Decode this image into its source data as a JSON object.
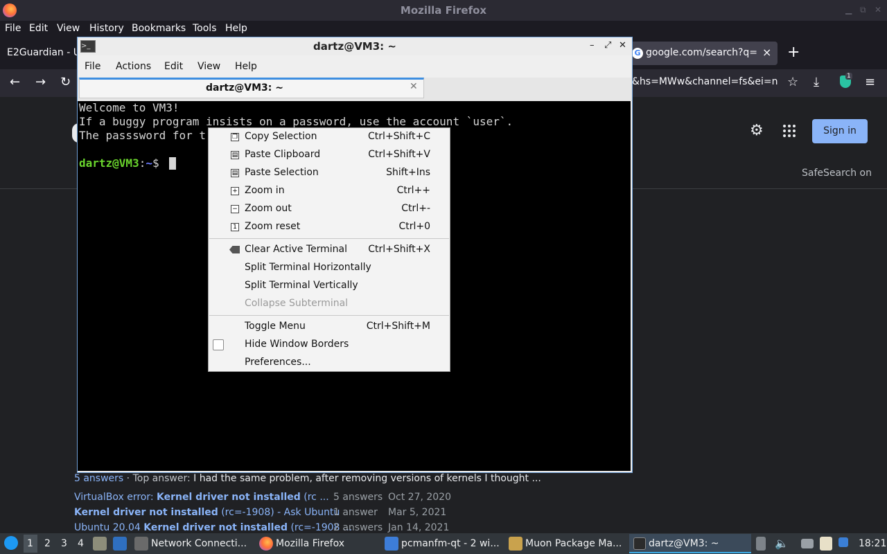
{
  "firefox": {
    "title": "Mozilla Firefox",
    "menu": [
      "File",
      "Edit",
      "View",
      "History",
      "Bookmarks",
      "Tools",
      "Help"
    ],
    "tab_left": "E2Guardian - U",
    "tab_active": "google.com/search?q=ke",
    "url_fragment": "&hs=MWw&channel=fs&ei=n",
    "extension_badge": "1"
  },
  "google": {
    "signin": "Sign in",
    "safesearch": "SafeSearch on",
    "snippet": {
      "count": "5 answers",
      "sep": " · ",
      "label": "Top answer:",
      "text": " I had the same problem, after removing versions of kernels I thought ..."
    },
    "related": [
      {
        "pre": "VirtualBox error: ",
        "bold": "Kernel driver not installed",
        "post": " (rc ...",
        "answers": "5 answers",
        "date": "Oct 27, 2020"
      },
      {
        "pre": "",
        "bold": "Kernel driver not installed",
        "post": " (rc=-1908) - Ask Ubuntu",
        "answers": "1 answer",
        "date": "Mar 5, 2021"
      },
      {
        "pre": "Ubuntu 20.04 ",
        "bold": "Kernel driver not installed",
        "post": " (rc=-1908 ...",
        "answers": "2 answers",
        "date": "Jan 14, 2021"
      }
    ]
  },
  "terminal": {
    "title": "dartz@VM3: ~",
    "menu": [
      "File",
      "Actions",
      "Edit",
      "View",
      "Help"
    ],
    "tab_label": "dartz@VM3: ~",
    "lines": [
      "Welcome to VM3!",
      "If a buggy program insists on a password, use the account `user`.",
      "The passsword for t"
    ],
    "prompt_user": "dartz@VM3",
    "prompt_colon": ":",
    "prompt_path": "~",
    "prompt_symbol": "$ "
  },
  "context_menu": {
    "items": [
      {
        "label": "Copy Selection",
        "shortcut": "Ctrl+Shift+C",
        "icon": "copy-icon"
      },
      {
        "label": "Paste Clipboard",
        "shortcut": "Ctrl+Shift+V",
        "icon": "paste-icon"
      },
      {
        "label": "Paste Selection",
        "shortcut": "Shift+Ins",
        "icon": "paste-icon"
      },
      {
        "label": "Zoom in",
        "shortcut": "Ctrl++",
        "icon": "zoom-in-icon"
      },
      {
        "label": "Zoom out",
        "shortcut": "Ctrl+-",
        "icon": "zoom-out-icon"
      },
      {
        "label": "Zoom reset",
        "shortcut": "Ctrl+0",
        "icon": "zoom-reset-icon"
      },
      {
        "label": "Clear Active Terminal",
        "shortcut": "Ctrl+Shift+X",
        "icon": "clear-icon"
      },
      {
        "label": "Split Terminal Horizontally",
        "shortcut": ""
      },
      {
        "label": "Split Terminal Vertically",
        "shortcut": ""
      },
      {
        "label": "Collapse Subterminal",
        "shortcut": "",
        "disabled": true
      },
      {
        "label": "Toggle Menu",
        "shortcut": "Ctrl+Shift+M"
      },
      {
        "label": "Hide Window Borders",
        "shortcut": "",
        "checkbox": false
      },
      {
        "label": "Preferences...",
        "shortcut": ""
      }
    ]
  },
  "taskbar": {
    "workspaces": [
      "1",
      "2",
      "3",
      "4"
    ],
    "tasks": [
      "Network Connecti...",
      "Mozilla Firefox",
      "pcmanfm-qt - 2 wi...",
      "Muon Package Ma...",
      "dartz@VM3: ~"
    ],
    "clock": "18:21"
  }
}
